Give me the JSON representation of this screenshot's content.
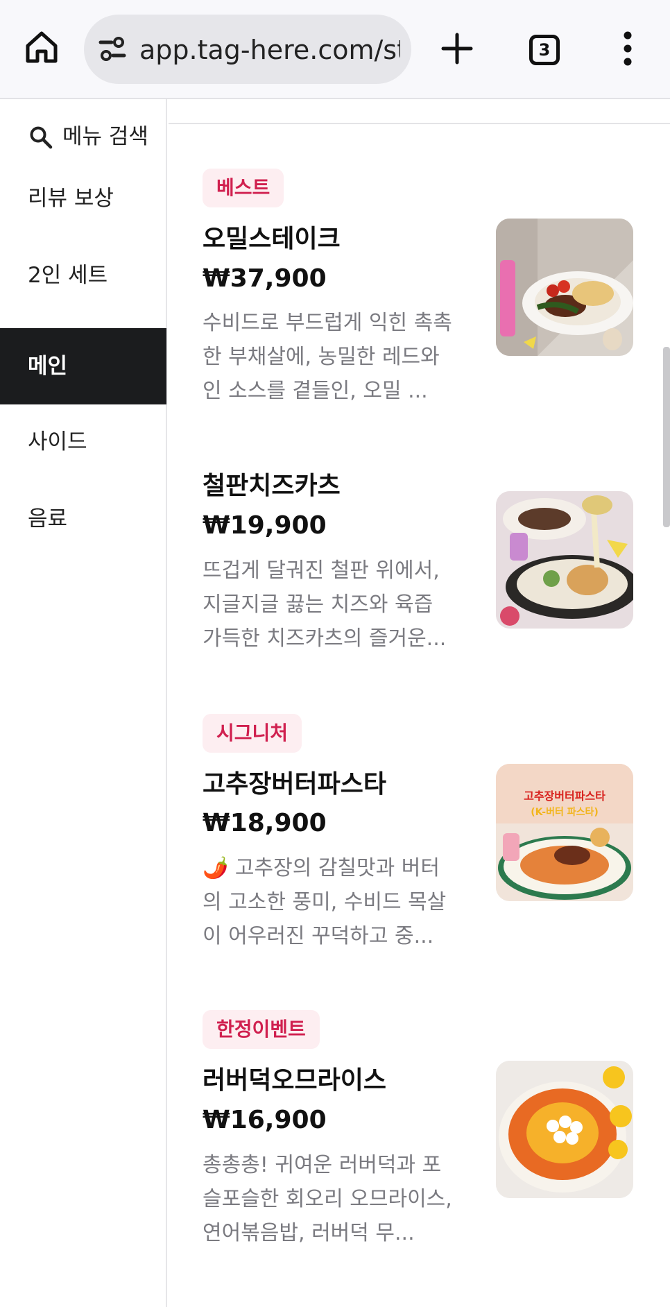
{
  "browser": {
    "url": "app.tag-here.com/store/m",
    "tab_count": "3",
    "icons": [
      "home-icon",
      "site-settings-icon",
      "plus-icon",
      "tab-switcher-icon",
      "more-vert-icon"
    ]
  },
  "sidebar": {
    "search_label": "메뉴 검색",
    "items": [
      {
        "label": "리뷰 보상",
        "active": false
      },
      {
        "label": "2인 세트",
        "active": false
      },
      {
        "label": "메인",
        "active": true
      },
      {
        "label": "사이드",
        "active": false
      },
      {
        "label": "음료",
        "active": false
      }
    ]
  },
  "menu": {
    "items": [
      {
        "badge": "베스트",
        "name": "오밀스테이크",
        "price": "₩37,900",
        "desc": "수비드로 부드럽게 익힌 촉촉한 부채살에, 농밀한 레드와인 소스를 곁들인, 오밀 ...",
        "image": "steak-plate-photo"
      },
      {
        "badge": "",
        "name": "철판치즈카츠",
        "price": "₩19,900",
        "desc": "뜨겁게 달궈진 철판 위에서, 지글지글 끓는 치즈와 육즙 가득한 치즈카츠의 즐거운...",
        "image": "cheese-katsu-photo"
      },
      {
        "badge": "시그니처",
        "name": "고추장버터파스타",
        "price": "₩18,900",
        "desc": "🌶️ 고추장의 감칠맛과 버터의 고소한 풍미, 수비드 목살이 어우러진 꾸덕하고 중...",
        "image": "gochujang-pasta-photo",
        "image_text": [
          "고추장버터파스타",
          "(K-버터 파스타)"
        ]
      },
      {
        "badge": "한정이벤트",
        "name": "러버덕오므라이스",
        "price": "₩16,900",
        "desc": "총총총! 귀여운 러버덕과 포슬포슬한 회오리 오므라이스, 연어볶음밥, 러버덕 무...",
        "image": "rubber-duck-omurice-photo"
      }
    ]
  },
  "colors": {
    "badge_bg": "#fdeef1",
    "badge_text": "#d0204f",
    "active_nav_bg": "#1b1c1e",
    "desc_text": "#7a7a80"
  }
}
